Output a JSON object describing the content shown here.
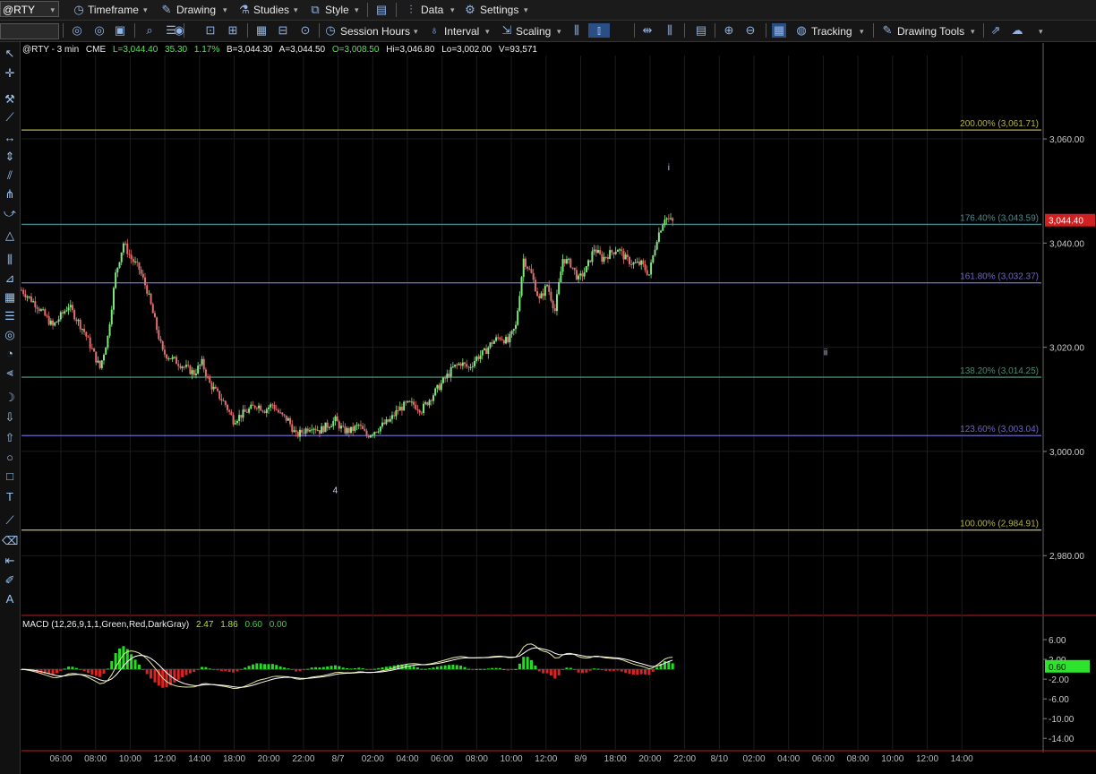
{
  "toolbar": {
    "symbol": "@RTY",
    "timeframe_label": "Timeframe",
    "drawing_label": "Drawing",
    "studies_label": "Studies",
    "style_label": "Style",
    "data_label": "Data",
    "settings_label": "Settings",
    "session_hours_label": "Session Hours",
    "interval_label": "Interval",
    "scaling_label": "Scaling",
    "tracking_label": "Tracking",
    "drawing_tools_label": "Drawing Tools"
  },
  "info": {
    "title": "@RTY - 3 min",
    "exchange": "CME",
    "last": "L=3,044.40",
    "change": "35.30",
    "pct": "1.17%",
    "bid": "B=3,044.30",
    "ask": "A=3,044.50",
    "open": "O=3,008.50",
    "high": "Hi=3,046.80",
    "low": "Lo=3,002.00",
    "volume": "V=93,571"
  },
  "macd_info": {
    "label": "MACD (12,26,9,1,1,Green,Red,DarkGray)",
    "v1": "2.47",
    "v2": "1.86",
    "v3": "0.60",
    "v4": "0.00"
  },
  "chart_data": {
    "type": "candlestick",
    "x_ticks": [
      "06:00",
      "08:00",
      "10:00",
      "12:00",
      "14:00",
      "18:00",
      "20:00",
      "22:00",
      "8/7",
      "02:00",
      "04:00",
      "06:00",
      "08:00",
      "10:00",
      "12:00",
      "8/9",
      "18:00",
      "20:00",
      "22:00",
      "8/10",
      "02:00",
      "04:00",
      "06:00",
      "08:00",
      "10:00",
      "12:00",
      "14:00"
    ],
    "y_ticks": [
      "3,060.00",
      "3,040.00",
      "3,020.00",
      "3,000.00",
      "2,980.00"
    ],
    "ylim": [
      2968,
      3076
    ],
    "last_price_label": "3,044.40",
    "price_path": [
      [
        0,
        3031
      ],
      [
        4,
        3028
      ],
      [
        8,
        3024
      ],
      [
        12,
        3028
      ],
      [
        16,
        3023
      ],
      [
        20,
        3016
      ],
      [
        22,
        3022
      ],
      [
        24,
        3034
      ],
      [
        26,
        3040
      ],
      [
        28,
        3037
      ],
      [
        30,
        3035
      ],
      [
        32,
        3031
      ],
      [
        34,
        3025
      ],
      [
        36,
        3019
      ],
      [
        38,
        3018
      ],
      [
        40,
        3017
      ],
      [
        42,
        3016
      ],
      [
        44,
        3015
      ],
      [
        46,
        3017
      ],
      [
        48,
        3013
      ],
      [
        50,
        3011
      ],
      [
        52,
        3009
      ],
      [
        54,
        3006
      ],
      [
        56,
        3007
      ],
      [
        58,
        3008
      ],
      [
        60,
        3009
      ],
      [
        62,
        3008
      ],
      [
        64,
        3009
      ],
      [
        66,
        3007
      ],
      [
        68,
        3006
      ],
      [
        70,
        3003
      ],
      [
        72,
        3004
      ],
      [
        74,
        3005
      ],
      [
        76,
        3004
      ],
      [
        78,
        3005
      ],
      [
        80,
        3006
      ],
      [
        82,
        3004
      ],
      [
        84,
        3004
      ],
      [
        86,
        3005
      ],
      [
        88,
        3003
      ],
      [
        90,
        3004
      ],
      [
        92,
        3005
      ],
      [
        94,
        3006
      ],
      [
        96,
        3008
      ],
      [
        98,
        3009
      ],
      [
        100,
        3009
      ],
      [
        102,
        3008
      ],
      [
        104,
        3010
      ],
      [
        106,
        3012
      ],
      [
        108,
        3014
      ],
      [
        110,
        3016
      ],
      [
        112,
        3017
      ],
      [
        114,
        3016
      ],
      [
        116,
        3018
      ],
      [
        118,
        3019
      ],
      [
        120,
        3021
      ],
      [
        122,
        3022
      ],
      [
        124,
        3021
      ],
      [
        126,
        3024
      ],
      [
        128,
        3037
      ],
      [
        130,
        3034
      ],
      [
        132,
        3029
      ],
      [
        134,
        3032
      ],
      [
        136,
        3027
      ],
      [
        138,
        3037
      ],
      [
        140,
        3036
      ],
      [
        142,
        3033
      ],
      [
        144,
        3035
      ],
      [
        146,
        3039
      ],
      [
        148,
        3037
      ],
      [
        150,
        3038
      ],
      [
        152,
        3039
      ],
      [
        154,
        3037
      ],
      [
        156,
        3036
      ],
      [
        158,
        3036
      ],
      [
        160,
        3034
      ],
      [
        162,
        3041
      ],
      [
        164,
        3045
      ],
      [
        166,
        3044
      ]
    ],
    "fib_levels": [
      {
        "label": "200.00% (3,061.71)",
        "value": 3061.71,
        "color": "#b5b04a"
      },
      {
        "label": "176.40% (3,043.59)",
        "value": 3043.59,
        "color": "#4a8a90"
      },
      {
        "label": "161.80% (3,032.37)",
        "value": 3032.37,
        "color": "#6e66c4"
      },
      {
        "label": "138.20% (3,014.25)",
        "value": 3014.25,
        "color": "#4a8a70"
      },
      {
        "label": "123.60% (3,003.04)",
        "value": 3003.04,
        "color": "#6e66c4"
      },
      {
        "label": "100.00% (2,984.91)",
        "value": 2984.91,
        "color": "#b5b04a"
      }
    ],
    "wave_labels": [
      {
        "text": "i",
        "t": 165,
        "price": 3054
      },
      {
        "text": "ii",
        "t": 205,
        "price": 3018.5
      },
      {
        "text": "4",
        "t": 80,
        "price": 2992
      }
    ],
    "macd": {
      "y_ticks": [
        "6.00",
        "2.00",
        "-2.00",
        "-6.00",
        "-10.00",
        "-14.00"
      ],
      "ylim": [
        -16.5,
        8
      ],
      "value_label": "0.60"
    }
  }
}
